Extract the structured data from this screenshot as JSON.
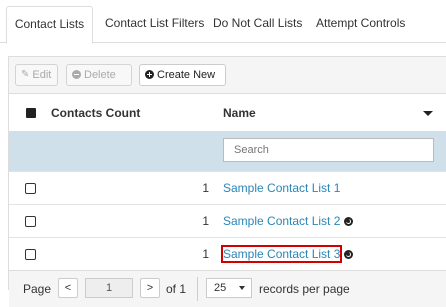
{
  "tabs": [
    {
      "label": "Contact Lists",
      "active": true
    },
    {
      "label": "Contact List Filters",
      "active": false
    },
    {
      "label": "Do Not Call Lists",
      "active": false
    },
    {
      "label": "Attempt Controls",
      "active": false
    }
  ],
  "toolbar": {
    "edit_label": "Edit",
    "delete_label": "Delete",
    "create_label": "Create New"
  },
  "table": {
    "columns": [
      "Contacts Count",
      "Name"
    ],
    "search_placeholder": "Search",
    "rows": [
      {
        "count": "1",
        "name": "Sample Contact List 1",
        "globe": false
      },
      {
        "count": "1",
        "name": "Sample Contact List 2",
        "globe": true
      },
      {
        "count": "1",
        "name": "Sample Contact List 3",
        "globe": true
      }
    ]
  },
  "pager": {
    "page_label": "Page",
    "prev": "<",
    "current_page": "1",
    "next": ">",
    "of_label": "of 1",
    "page_size": "25",
    "records_label": "records per page"
  },
  "colors": {
    "link": "#2a86b6",
    "filter_row": "#cfe0ea",
    "highlight": "#d40000"
  }
}
